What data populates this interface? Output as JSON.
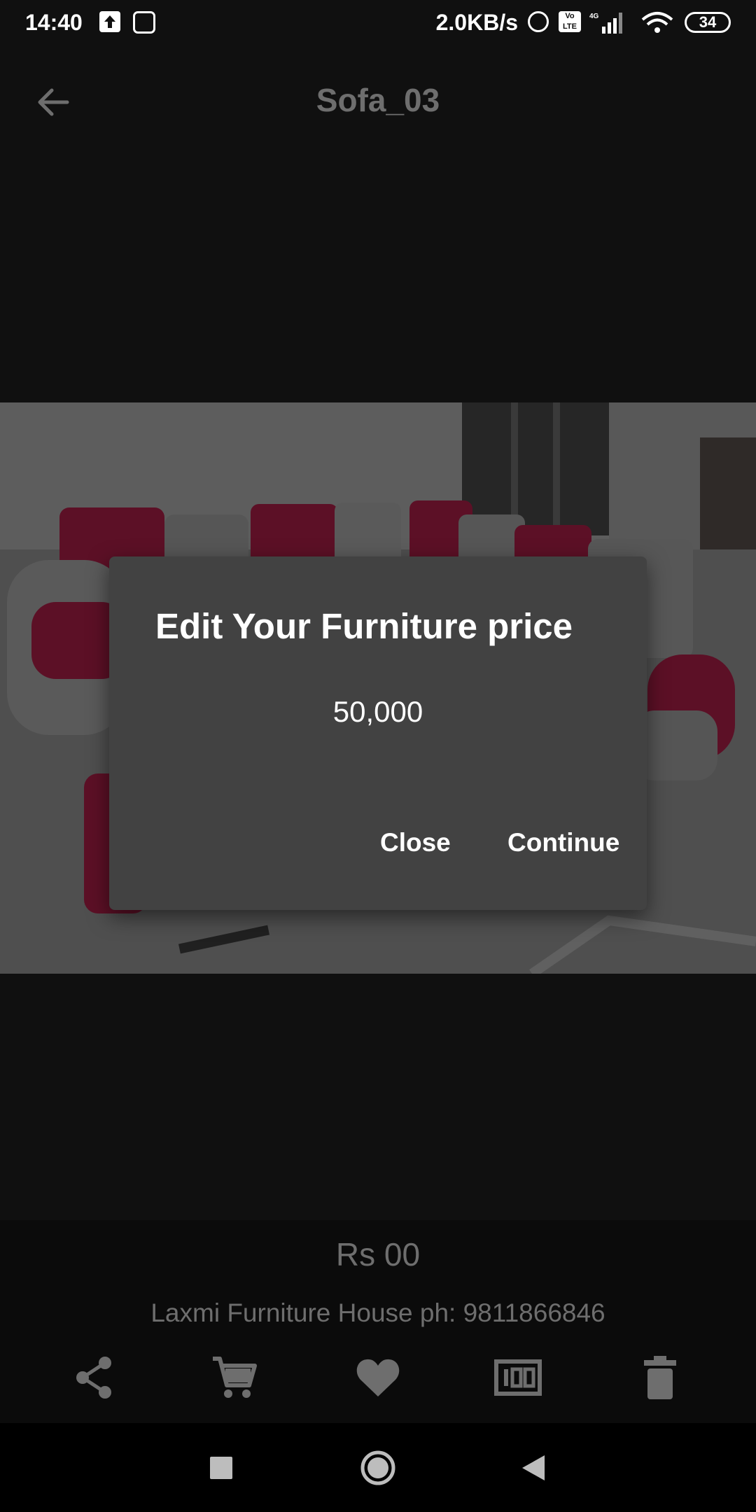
{
  "status_bar": {
    "time": "14:40",
    "net_speed": "2.0KB/s",
    "volte": "Vo LTE",
    "network": "4G",
    "battery": "34"
  },
  "app_bar": {
    "title": "Sofa_03"
  },
  "dialog": {
    "title": "Edit Your Furniture price",
    "value": "50,000",
    "close_label": "Close",
    "continue_label": "Continue"
  },
  "product": {
    "price": "Rs 00",
    "vendor": "Laxmi Furniture House ph: 9811866846"
  },
  "colors": {
    "background": "#101010",
    "dialog": "#424242",
    "muted_text": "#6e6e6e",
    "sofa_red": "#9b1240"
  }
}
